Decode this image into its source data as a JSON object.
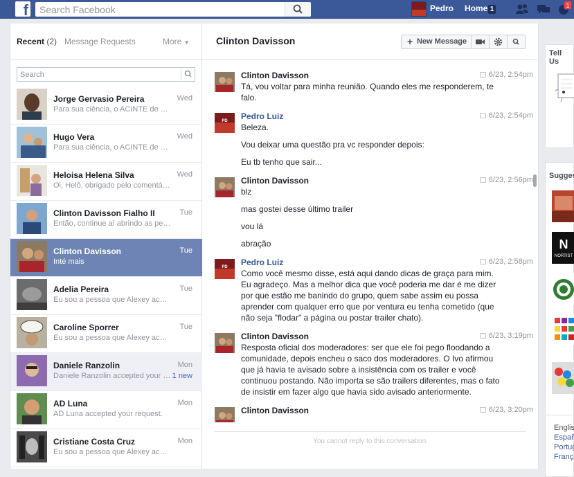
{
  "topbar": {
    "logo": "f",
    "search_placeholder": "Search Facebook",
    "profile_name": "Pedro",
    "home_label": "Home",
    "home_count": "1",
    "notification_count": "1"
  },
  "left": {
    "tab_recent": "Recent",
    "tab_recent_count": "(2)",
    "tab_requests": "Message Requests",
    "tab_more": "More",
    "search_placeholder": "Search",
    "threads": [
      {
        "name": "Jorge Gervasio Pereira",
        "preview": "Para sua ciência, o ACINTE de Cl...",
        "date": "Wed"
      },
      {
        "name": "Hugo Vera",
        "preview": "Para sua ciência, o ACINTE de Cl...",
        "date": "Wed"
      },
      {
        "name": "Heloisa Helena Silva",
        "preview": "Oi, Helô, obrigado pelo comentári...",
        "date": "Wed"
      },
      {
        "name": "Clinton Davisson Fialho II",
        "preview": "Então, continue aí abrindo as pern...",
        "date": "Tue"
      },
      {
        "name": "Clinton Davisson",
        "preview": "Inté mais",
        "date": "Tue"
      },
      {
        "name": "Adelia Pereira",
        "preview": "Eu sou a pessoa que Alexey acus...",
        "date": "Tue"
      },
      {
        "name": "Caroline Sporrer",
        "preview": "Eu sou a pessoa que Alexey acus...",
        "date": "Tue"
      },
      {
        "name": "Daniele Ranzolin",
        "preview": "Daniele Ranzolin accepted your r...",
        "date": "Mon",
        "new_label": "1 new"
      },
      {
        "name": "AD Luna",
        "preview": "AD Luna accepted your request.",
        "date": "Mon"
      },
      {
        "name": "Cristiane Costa Cruz",
        "preview": "Eu sou a pessoa que Alexey acus...",
        "date": "Mon"
      }
    ]
  },
  "conversation": {
    "title": "Clinton Davisson",
    "new_message_label": "New Message",
    "messages": [
      {
        "sender": "Clinton Davisson",
        "time": "6/23, 2:54pm",
        "lines": [
          "Tá, vou voltar para minha reunião. Quando eles me responderem, te falo."
        ]
      },
      {
        "sender": "Pedro Luiz",
        "time": "6/23, 2:54pm",
        "lines": [
          "Beleza.",
          "Vou deixar uma questão pra vc responder depois:",
          "Eu tb tenho que sair..."
        ]
      },
      {
        "sender": "Clinton Davisson",
        "time": "6/23, 2:56pm",
        "lines": [
          "blz",
          "mas gostei desse último trailer",
          "vou lá",
          "abração"
        ]
      },
      {
        "sender": "Pedro Luiz",
        "time": "6/23, 2:58pm",
        "lines": [
          "Como você mesmo disse, está aqui dando dicas de graça para mim. Eu agradeço. Mas a melhor dica que você poderia me dar é me dizer por que estão me banindo do grupo, quem sabe assim eu possa aprender com qualquer erro que por ventura eu tenha cometido (que não seja \"flodar\" a página ou postar trailer chato)."
        ]
      },
      {
        "sender": "Clinton Davisson",
        "time": "6/23, 3:19pm",
        "lines": [
          "Resposta oficial dos moderadores: ser que ele foi pego floodando a comunidade, depois encheu o saco dos moderadores. O Ivo afirmou que já havia te avisado sobre a insistência com os trailer e você continuou postando. Não importa se são trailers diferentes, mas o fato de insistir em fazer algo que havia sido avisado anteriormente."
        ]
      },
      {
        "sender": "Clinton Davisson",
        "time": "6/23, 3:20pm",
        "lines": []
      }
    ],
    "reply_note": "You cannot reply to this conversation."
  },
  "right": {
    "tell_us": "Tell Us",
    "suggested": "Sugges",
    "languages": [
      "English",
      "Españ",
      "Portug",
      "França"
    ]
  },
  "colors": {
    "brand": "#3b5998",
    "active_thread": "#6d84b4",
    "link": "#365899"
  }
}
